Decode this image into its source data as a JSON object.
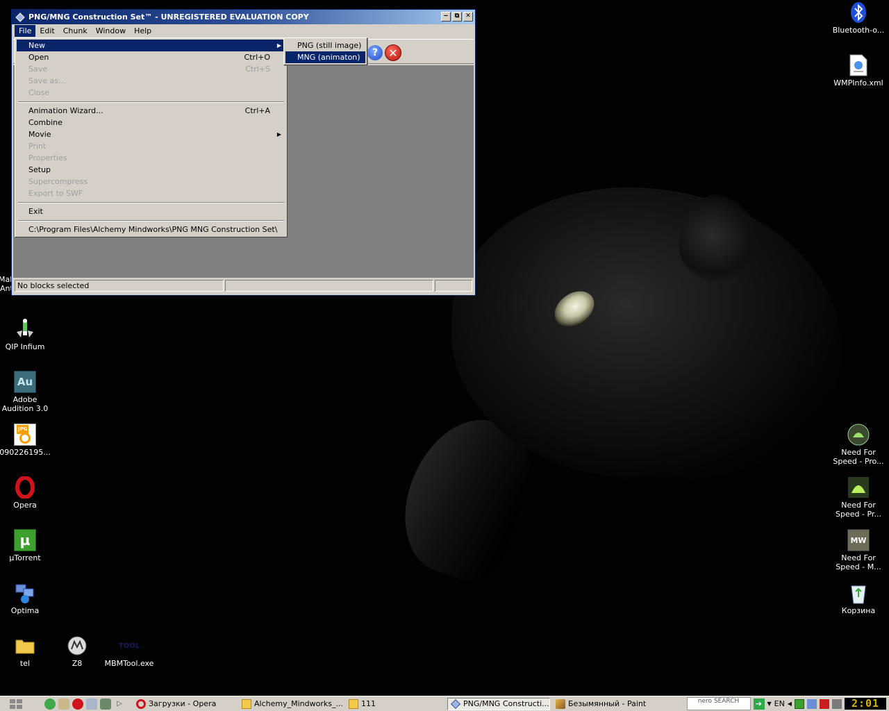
{
  "window": {
    "title": "PNG/MNG Construction Set™ - UNREGISTERED EVALUATION COPY",
    "controls": {
      "minimize": "‒",
      "maximize": "⧉",
      "close": "✕"
    },
    "menubar": [
      "File",
      "Edit",
      "Chunk",
      "Window",
      "Help"
    ],
    "toolbar": {
      "help_glyph": "?",
      "exit_glyph": "✕"
    },
    "status": {
      "pane1": "No blocks selected",
      "pane2": "",
      "pane3": ""
    }
  },
  "file_menu": {
    "items": [
      {
        "label": "New",
        "shortcut": "",
        "submenu": true,
        "disabled": false,
        "highlighted": true
      },
      {
        "label": "Open",
        "shortcut": "Ctrl+O",
        "submenu": false,
        "disabled": false
      },
      {
        "label": "Save",
        "shortcut": "Ctrl+S",
        "submenu": false,
        "disabled": true
      },
      {
        "label": "Save as...",
        "shortcut": "",
        "submenu": false,
        "disabled": true
      },
      {
        "label": "Close",
        "shortcut": "",
        "submenu": false,
        "disabled": true
      },
      {
        "label": "Animation Wizard...",
        "shortcut": "Ctrl+A",
        "submenu": false,
        "disabled": false
      },
      {
        "label": "Combine",
        "shortcut": "",
        "submenu": false,
        "disabled": false
      },
      {
        "label": "Movie",
        "shortcut": "",
        "submenu": true,
        "disabled": false
      },
      {
        "label": "Print",
        "shortcut": "",
        "submenu": false,
        "disabled": true
      },
      {
        "label": "Properties",
        "shortcut": "",
        "submenu": false,
        "disabled": true
      },
      {
        "label": "Setup",
        "shortcut": "",
        "submenu": false,
        "disabled": false
      },
      {
        "label": "Supercompress",
        "shortcut": "",
        "submenu": false,
        "disabled": true
      },
      {
        "label": "Export to SWF",
        "shortcut": "",
        "submenu": false,
        "disabled": true
      },
      {
        "label": "Exit",
        "shortcut": "",
        "submenu": false,
        "disabled": false
      },
      {
        "label": "C:\\Program Files\\Alchemy Mindworks\\PNG MNG Construction Set\\",
        "shortcut": "",
        "submenu": false,
        "disabled": false
      }
    ],
    "arrow_glyph": "▶"
  },
  "new_submenu": {
    "items": [
      {
        "label": "PNG (still image)",
        "highlighted": false
      },
      {
        "label": "MNG (animaton)",
        "highlighted": true
      }
    ]
  },
  "desktop_icons": {
    "left": [
      {
        "label": "Malwarebytes' Anti-Malware",
        "icon": "shield-icon"
      },
      {
        "label": "QIP Infium",
        "icon": "qip-icon"
      },
      {
        "label": "Adobe Audition 3.0",
        "icon": "audition-icon"
      },
      {
        "label": "090226195...",
        "icon": "jpg-file-icon"
      },
      {
        "label": "Opera",
        "icon": "opera-icon"
      },
      {
        "label": "µTorrent",
        "icon": "utorrent-icon"
      },
      {
        "label": "Optima",
        "icon": "network-icon"
      },
      {
        "label": "tel",
        "icon": "folder-icon"
      },
      {
        "label": "Z8",
        "icon": "motorola-icon"
      },
      {
        "label": "MBMTool.exe",
        "icon": "exe-icon"
      }
    ],
    "right": [
      {
        "label": "Bluetooth-o...",
        "icon": "bluetooth-icon"
      },
      {
        "label": "WMPInfo.xml",
        "icon": "xml-file-icon"
      },
      {
        "label": "Need For Speed - Pro...",
        "icon": "nfs-prostreet-icon"
      },
      {
        "label": "Need For Speed - Pr...",
        "icon": "nfs-icon"
      },
      {
        "label": "Need For Speed - M...",
        "icon": "nfs-mw-icon"
      },
      {
        "label": "Корзина",
        "icon": "recycle-bin-icon"
      }
    ],
    "au_text": "Au",
    "jpg_text": "JPG",
    "mw_text": "MW",
    "mbm_text": "TOOL"
  },
  "taskbar": {
    "tasks": [
      {
        "label": "Загрузки - Opera",
        "active": false,
        "icon": "opera-icon"
      },
      {
        "label": "Alchemy_Mindworks_...",
        "active": false,
        "icon": "folder-icon"
      },
      {
        "label": "111",
        "active": false,
        "icon": "folder-icon"
      },
      {
        "label": "PNG/MNG Constructi...",
        "active": true,
        "icon": "png-mng-icon"
      },
      {
        "label": "Безымянный - Paint",
        "active": false,
        "icon": "paint-icon"
      }
    ],
    "nero": "nero SEARCH",
    "language": "EN",
    "clock": "2:01",
    "colors": {
      "accent": "#0a246a",
      "taskbar": "#d4d0c8"
    }
  }
}
